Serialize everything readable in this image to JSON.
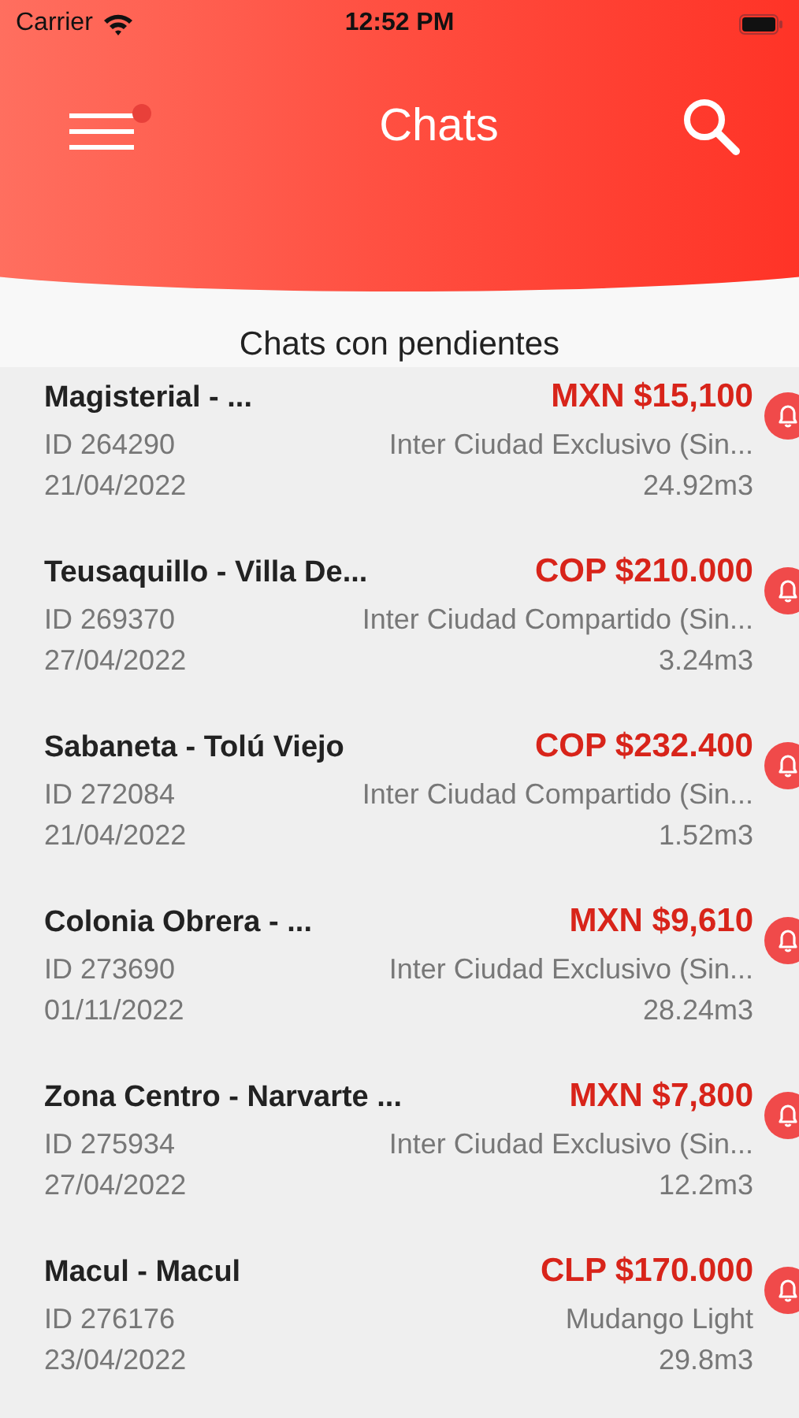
{
  "status_bar": {
    "carrier": "Carrier",
    "time": "12:52 PM"
  },
  "header": {
    "title": "Chats",
    "menu_has_notification": true
  },
  "section_title": "Chats con pendientes",
  "chats": [
    {
      "name": "Magisterial - ...",
      "price": "MXN $15,100",
      "id": "ID 264290",
      "service": "Inter Ciudad Exclusivo (Sin...",
      "date": "21/04/2022",
      "volume": "24.92m3",
      "alert": true
    },
    {
      "name": "Teusaquillo - Villa De...",
      "price": "COP $210.000",
      "id": "ID 269370",
      "service": "Inter Ciudad Compartido (Sin...",
      "date": "27/04/2022",
      "volume": "3.24m3",
      "alert": true
    },
    {
      "name": "Sabaneta - Tolú Viejo",
      "price": "COP $232.400",
      "id": "ID 272084",
      "service": "Inter Ciudad Compartido (Sin...",
      "date": "21/04/2022",
      "volume": "1.52m3",
      "alert": true
    },
    {
      "name": "Colonia Obrera - ...",
      "price": "MXN $9,610",
      "id": "ID 273690",
      "service": "Inter Ciudad Exclusivo (Sin...",
      "date": "01/11/2022",
      "volume": "28.24m3",
      "alert": true
    },
    {
      "name": "Zona Centro - Narvarte ...",
      "price": "MXN $7,800",
      "id": "ID 275934",
      "service": "Inter Ciudad Exclusivo (Sin...",
      "date": "27/04/2022",
      "volume": "12.2m3",
      "alert": true
    },
    {
      "name": "Macul - Macul",
      "price": "CLP $170.000",
      "id": "ID 276176",
      "service": "Mudango Light",
      "date": "23/04/2022",
      "volume": "29.8m3",
      "alert": true
    }
  ]
}
